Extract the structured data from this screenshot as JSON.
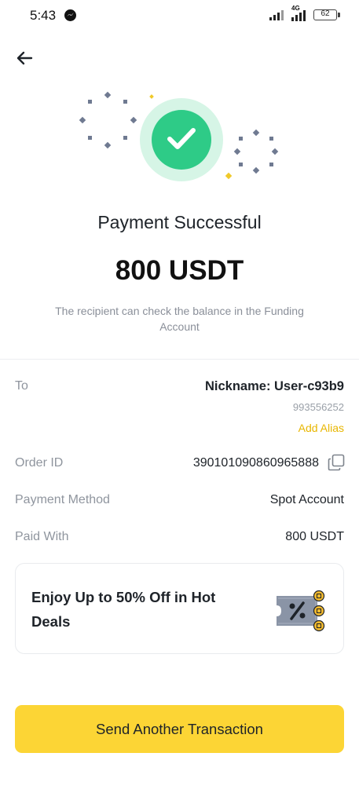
{
  "status_bar": {
    "time": "5:43",
    "network_label": "4G",
    "battery": "62",
    "notification_icon": "messenger-icon"
  },
  "header": {
    "back_icon": "arrow-left-icon"
  },
  "result": {
    "icon": "check-circle-icon",
    "accent_color": "#2ecb87",
    "title": "Payment Successful",
    "amount": "800 USDT",
    "note": "The recipient can check the balance in the Funding Account"
  },
  "details": {
    "to": {
      "label": "To",
      "nickname": "Nickname: User-c93b9",
      "user_id": "993556252",
      "add_alias": "Add Alias"
    },
    "order": {
      "label": "Order ID",
      "value": "390101090860965888",
      "copy_icon": "copy-icon"
    },
    "method": {
      "label": "Payment Method",
      "value": "Spot Account"
    },
    "paid": {
      "label": "Paid With",
      "value": "800 USDT"
    }
  },
  "promo": {
    "text": "Enjoy Up to 50% Off in Hot Deals",
    "icon": "discount-coupon-icon"
  },
  "cta": {
    "label": "Send Another Transaction",
    "color": "#fcd535"
  },
  "colors": {
    "link": "#e8b600",
    "secondary_text": "#8f959e"
  }
}
